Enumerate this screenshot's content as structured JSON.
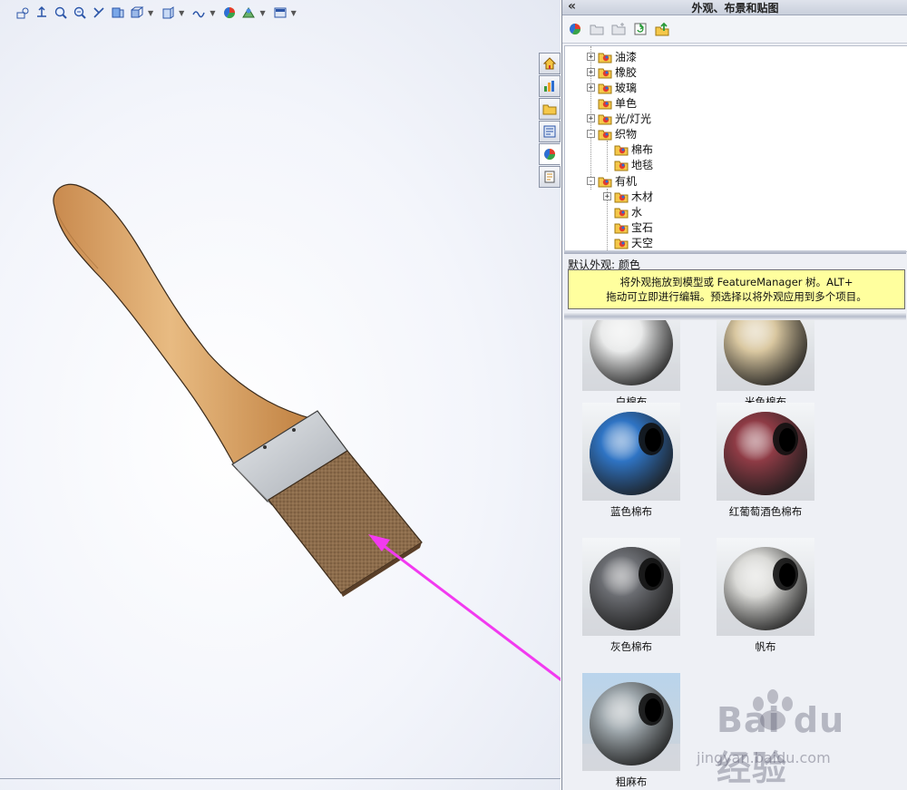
{
  "pane": {
    "title": "外观、布景和贴图",
    "collapse": "«"
  },
  "view_toolbar": {
    "icons": [
      "zoom-to-fit-icon",
      "zoom-area-icon",
      "zoom-in-out-icon",
      "previous-view-icon",
      "section-view-icon",
      "view-orientation-icon",
      "display-style-icon",
      "hide-show-items-icon",
      "edit-appearance-icon",
      "apply-scene-icon",
      "view-settings-icon"
    ]
  },
  "tree": {
    "items": [
      {
        "label": "油漆",
        "level": 1,
        "expand": "+"
      },
      {
        "label": "橡胶",
        "level": 1,
        "expand": "+"
      },
      {
        "label": "玻璃",
        "level": 1,
        "expand": "+"
      },
      {
        "label": "单色",
        "level": 1,
        "expand": ""
      },
      {
        "label": "光/灯光",
        "level": 1,
        "expand": "+"
      },
      {
        "label": "织物",
        "level": 1,
        "expand": "-"
      },
      {
        "label": "棉布",
        "level": 2,
        "expand": ""
      },
      {
        "label": "地毯",
        "level": 2,
        "expand": ""
      },
      {
        "label": "有机",
        "level": 1,
        "expand": "-"
      },
      {
        "label": "木材",
        "level": 2,
        "expand": "+"
      },
      {
        "label": "水",
        "level": 2,
        "expand": ""
      },
      {
        "label": "宝石",
        "level": 2,
        "expand": ""
      },
      {
        "label": "天空",
        "level": 2,
        "expand": ""
      }
    ]
  },
  "default_appearance": "默认外观: 颜色",
  "tooltip": {
    "line1": "将外观拖放到模型或 FeatureManager 树。ALT+",
    "line2": "拖动可立即进行编辑。预选择以将外观应用到多个项目。"
  },
  "swatches": [
    {
      "label": "白棉布",
      "color": "#e9eaea"
    },
    {
      "label": "米色棉布",
      "color": "#d9c7a0"
    },
    {
      "label": "蓝色棉布",
      "color": "#2f74c4"
    },
    {
      "label": "红葡萄酒色棉布",
      "color": "#8e3b45"
    },
    {
      "label": "灰色棉布",
      "color": "#6b6d72"
    },
    {
      "label": "帆布",
      "color": "#d9d9d6"
    },
    {
      "label": "粗麻布",
      "color": "#9fa8ad"
    }
  ],
  "watermark": {
    "main": "Bai du 经验",
    "sub": "jingyan.baidu.com"
  },
  "colors": {
    "wood": "#d9a56c",
    "ferrule": "#bfc3c8",
    "bristles": "#8a6a4a",
    "arrow": "#f23af0"
  }
}
